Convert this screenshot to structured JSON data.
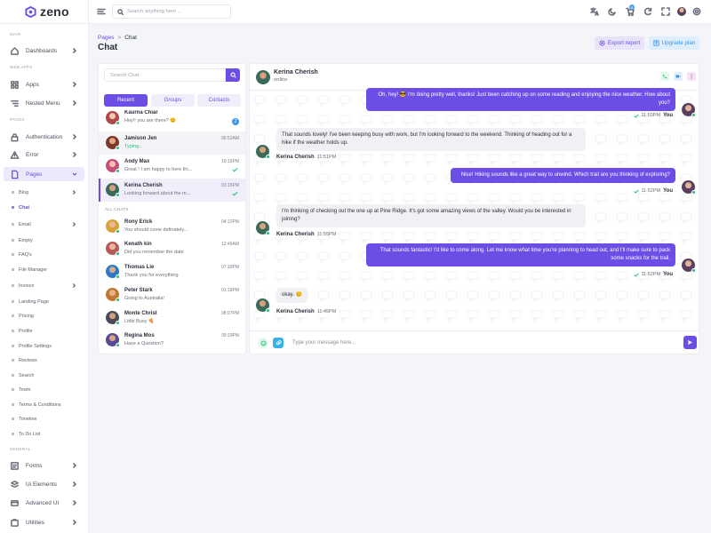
{
  "app": {
    "name": "zeno"
  },
  "sidebar": {
    "sections": {
      "main": "MAIN",
      "web_apps": "WEB APPS",
      "pages": "PAGES",
      "general": "GENERAL"
    },
    "items": [
      {
        "label": "Dashboards",
        "icon": "home-icon"
      },
      {
        "label": "Apps",
        "icon": "apps-icon"
      },
      {
        "label": "Nested Menu",
        "icon": "nested-icon"
      },
      {
        "label": "Authentication",
        "icon": "lock-icon"
      },
      {
        "label": "Error",
        "icon": "error-icon"
      },
      {
        "label": "Pages",
        "icon": "pages-icon"
      },
      {
        "label": "Forms",
        "icon": "forms-icon"
      },
      {
        "label": "Ui Elements",
        "icon": "ui-icon"
      },
      {
        "label": "Advanced UI",
        "icon": "advanced-icon"
      },
      {
        "label": "Utilities",
        "icon": "utilities-icon"
      }
    ],
    "pages_sub": [
      "Blog",
      "Chat",
      "Email",
      "Empty",
      "FAQ's",
      "File Manager",
      "Invoice",
      "Landing Page",
      "Pricing",
      "Profile",
      "Profile Settings",
      "Reviews",
      "Search",
      "Team",
      "Terms & Conditions",
      "Timeline",
      "To Do List"
    ]
  },
  "header": {
    "search_placeholder": "Search anything here ...",
    "cart_count": "5"
  },
  "page": {
    "breadcrumb_parent": "Pages",
    "breadcrumb_sep": ">",
    "breadcrumb_current": "Chat",
    "title": "Chat",
    "export_label": "Export report",
    "upgrade_label": "Upgrade plan"
  },
  "chat_list": {
    "search_placeholder": "Search Chat",
    "tabs": [
      "Recent",
      "Groups",
      "Contacts"
    ],
    "all_chats_label": "ALL CHATS",
    "recent": [
      {
        "name": "Kaurna Chiar",
        "msg": "Hey!! you are there? 😊",
        "time": "",
        "unread": "2",
        "color": "#d9a48a"
      },
      {
        "name": "Jamison Jen",
        "msg": "Typing...",
        "time": "06:52AM",
        "typing": true,
        "color": "#c47a5a"
      },
      {
        "name": "Andy Max",
        "msg": "Great ! I am happy to here thi...",
        "time": "10:15PM",
        "check": true,
        "color": "#d68aa0"
      },
      {
        "name": "Kerina Cherish",
        "msg": "Looking forward about the m...",
        "time": "03:15PM",
        "check": true,
        "color": "#7a5c48"
      }
    ],
    "all": [
      {
        "name": "Rony Erick",
        "msg": "You should come definately...",
        "time": "04:12PM",
        "color": "#e0b24a"
      },
      {
        "name": "Kenath kin",
        "msg": "Did you remember the date",
        "time": "12:46AM",
        "color": "#c66a6a"
      },
      {
        "name": "Thomas Lie",
        "msg": "Thank you for everything",
        "time": "07:30PM",
        "color": "#4a86c6"
      },
      {
        "name": "Peter Stark",
        "msg": "Going to Australia!",
        "time": "01:18PM",
        "color": "#c9874f"
      },
      {
        "name": "Monte Christ",
        "msg": "Little Busy 🍕",
        "time": "08:07PM",
        "color": "#6a6a7a"
      },
      {
        "name": "Regina Mos",
        "msg": "Have a Question?",
        "time": "09:19PM",
        "color": "#6a58a6"
      }
    ]
  },
  "chat": {
    "contact_name": "Kerina Cherish",
    "contact_status": "online",
    "input_placeholder": "Type your message here...",
    "you_label": "You",
    "contact_label": "Kerina Cherish",
    "messages": [
      {
        "dir": "out",
        "text": "Oh, hey! 😎 I'm doing pretty well, thanks! Just been catching up on some reading and enjoying the nice weather. How about you?",
        "time": "11:50PM"
      },
      {
        "dir": "in",
        "text": "That sounds lovely! I've been keeping busy with work, but I'm looking forward to the weekend. Thinking of heading out for a hike if the weather holds up.",
        "time": "11:51PM"
      },
      {
        "dir": "out",
        "text": "Nice! Hiking sounds like a great way to unwind. Which trail are you thinking of exploring?",
        "time": "11:52PM"
      },
      {
        "dir": "in",
        "text": "I'm thinking of checking out the one up at Pine Ridge. It's got some amazing views of the valley. Would you be interested in joining?",
        "time": "11:55PM"
      },
      {
        "dir": "out",
        "text": "That sounds fantastic! I'd like to come along. Let me know what time you're planning to head out, and I'll make sure to pack some snacks for the trail.",
        "time": "11:52PM"
      },
      {
        "dir": "in",
        "text": "okay. 😊",
        "time": "11:45PM"
      }
    ]
  },
  "colors": {
    "accent": "#6c4ee6",
    "accent_soft": "#ede9fc",
    "online": "#26bf7a",
    "info": "#3a97ea"
  }
}
